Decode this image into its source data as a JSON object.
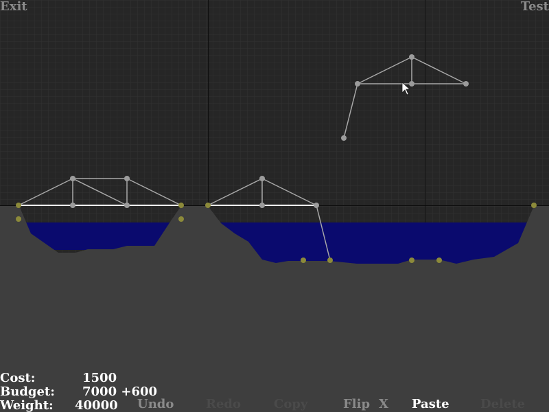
{
  "menu": {
    "exit_label": "Exit",
    "test_label": "Test"
  },
  "stats": {
    "cost_label": "Cost:",
    "cost_value": "1500",
    "budget_label": "Budget:",
    "budget_value": "7000 +600",
    "weight_label": "Weight:",
    "weight_value": "40000"
  },
  "toolbar": {
    "undo_label": "Undo",
    "redo_label": "Redo",
    "copy_label": "Copy",
    "flip_label": "Flip",
    "flip_x_label": "X",
    "paste_label": "Paste",
    "delete_label": "Delete"
  },
  "colors": {
    "background": "#262626",
    "grid": "#343434",
    "grid_major": "#0a0a0a",
    "terrain": "#3e3e3e",
    "water": "#0a0a6e",
    "beam": "#aaaaaa",
    "road": "#ffffff",
    "joint": "#9a9a9a",
    "anchor": "#8c8a3a"
  }
}
